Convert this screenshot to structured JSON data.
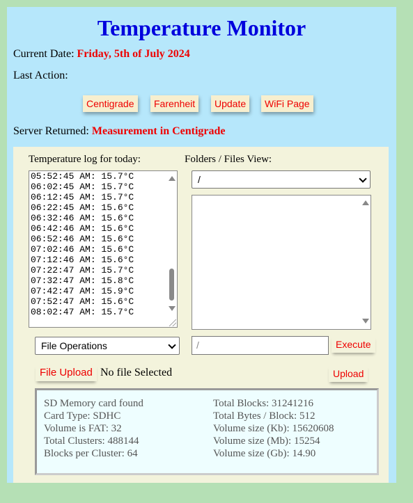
{
  "title": "Temperature Monitor",
  "current_date": {
    "label": "Current Date:",
    "value": "Friday, 5th of July 2024"
  },
  "last_action": {
    "label": "Last Action:",
    "value": ""
  },
  "buttons": {
    "centigrade": "Centigrade",
    "farenheit": "Farenheit",
    "update": "Update",
    "wifi": "WiFi Page"
  },
  "server": {
    "label": "Server Returned:",
    "value": "Measurement in Centigrade"
  },
  "log": {
    "label": "Temperature log for today:",
    "text": "05:52:45 AM: 15.7°C\n06:02:45 AM: 15.7°C\n06:12:45 AM: 15.7°C\n06:22:45 AM: 15.6°C\n06:32:46 AM: 15.6°C\n06:42:46 AM: 15.6°C\n06:52:46 AM: 15.6°C\n07:02:46 AM: 15.6°C\n07:12:46 AM: 15.6°C\n07:22:47 AM: 15.7°C\n07:32:47 AM: 15.8°C\n07:42:47 AM: 15.9°C\n07:52:47 AM: 15.6°C\n08:02:47 AM: 15.7°C"
  },
  "files": {
    "label": "Folders / Files View:",
    "folder_selected": "/"
  },
  "operations": {
    "selected": "File Operations",
    "path_placeholder": "/",
    "execute": "Execute"
  },
  "upload": {
    "file_upload": "File Upload",
    "status": "No file Selected",
    "upload": "Upload"
  },
  "sd_info": {
    "left": [
      "SD Memory card found",
      "Card Type: SDHC",
      "Volume is FAT: 32",
      "Total Clusters: 488144",
      "Blocks per Cluster: 64"
    ],
    "right": [
      "Total Blocks: 31241216",
      "Total Bytes / Block: 512",
      "Volume size (Kb): 15620608",
      "Volume size (Mb): 15254",
      "Volume size (Gb): 14.90"
    ]
  },
  "colors": {
    "title": "#0000dd",
    "accent_red": "#ee0000",
    "panel": "#b6e7fb",
    "inner": "#f3f3dc",
    "background": "#b5e0b5"
  }
}
